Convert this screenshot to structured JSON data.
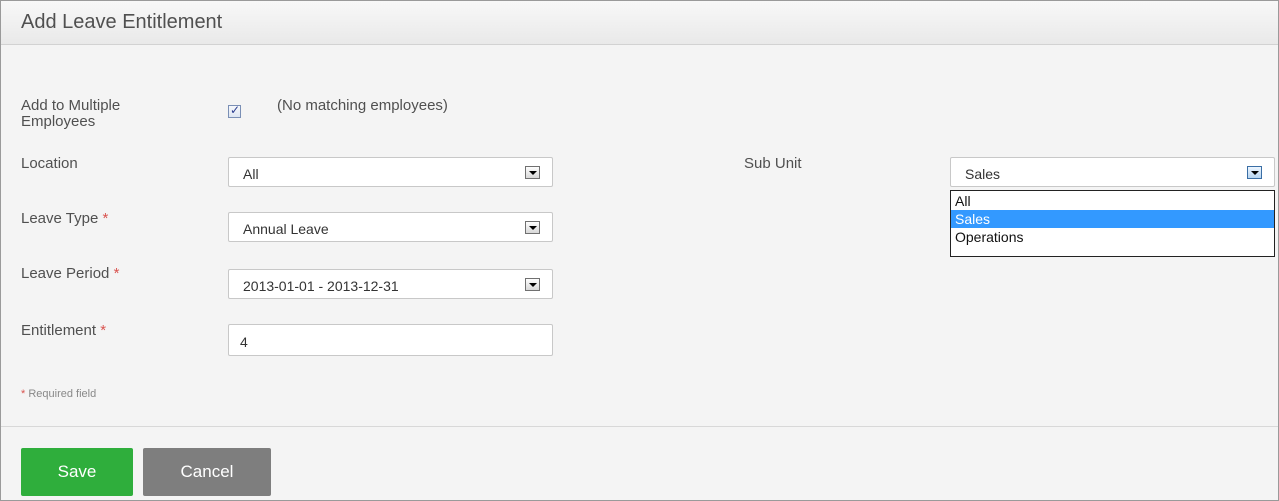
{
  "header": {
    "title": "Add Leave Entitlement"
  },
  "form": {
    "multiple": {
      "label": "Add to Multiple Employees",
      "checked": true,
      "status": "(No matching employees)"
    },
    "location": {
      "label": "Location",
      "value": "All"
    },
    "sub_unit": {
      "label": "Sub Unit",
      "value": "Sales",
      "options": [
        "All",
        "Sales",
        "Operations"
      ],
      "highlighted_option": "Sales"
    },
    "leave_type": {
      "label": "Leave Type",
      "required_marker": "*",
      "value": "Annual Leave"
    },
    "leave_period": {
      "label": "Leave Period",
      "required_marker": "*",
      "value": "2013-01-01 - 2013-12-31"
    },
    "entitlement": {
      "label": "Entitlement",
      "required_marker": "*",
      "value": "4"
    },
    "required_note": {
      "marker": "*",
      "text": "Required field"
    }
  },
  "actions": {
    "save_label": "Save",
    "cancel_label": "Cancel"
  },
  "colors": {
    "save": "#2fae3c",
    "cancel": "#7e7e7e",
    "required": "#d9534f",
    "highlight": "#3399ff"
  },
  "icons": {
    "checkbox": "check-icon",
    "dropdown": "chevron-down-icon"
  }
}
